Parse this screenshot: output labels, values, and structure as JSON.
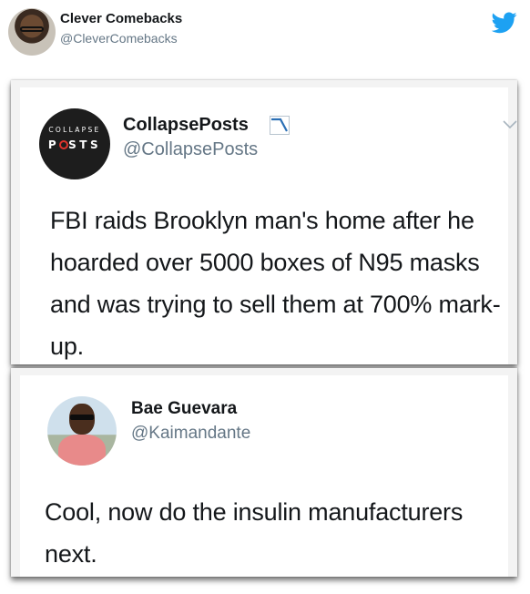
{
  "outer": {
    "name": "Clever Comebacks",
    "handle": "@CleverComebacks",
    "brand_icon": "twitter-bird-icon",
    "brand_color": "#1da1f2"
  },
  "tweets": [
    {
      "avatar_line1": "COLLAPSE",
      "avatar_line2_pre": "P",
      "avatar_line2_post": "STS",
      "name": "CollapsePosts",
      "badge_icon": "chart-down-icon",
      "handle": "@CollapsePosts",
      "menu_icon": "chevron-down-icon",
      "text": "FBI raids Brooklyn man's home after he hoarded over 5000 boxes of N95 masks and was trying to sell them at 700% mark-up."
    },
    {
      "name": "Bae Guevara",
      "handle": "@Kaimandante",
      "text": "Cool, now do the insulin manufacturers next."
    }
  ]
}
